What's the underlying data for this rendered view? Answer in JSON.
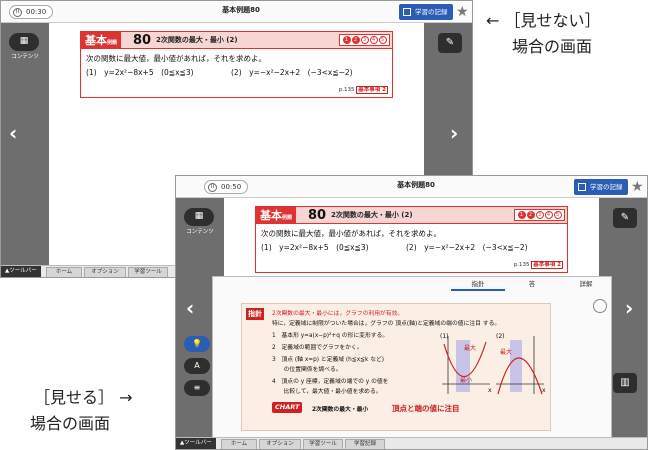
{
  "annotations": {
    "hidden_line1": "← ［見せない］",
    "hidden_line2": "場合の画面",
    "shown_line1": "［見せる］ →",
    "shown_line2": "場合の画面"
  },
  "common": {
    "app_title": "基本例題80",
    "record_label": "学習の記録",
    "star": "★",
    "contents_label": "コンテンツ",
    "toolbar_label": "▲ツールバー",
    "toolbar_tabs": [
      "ホーム",
      "オプション",
      "学習ツール",
      "学習記録"
    ],
    "problem": {
      "kihon": "基本",
      "kihon_small": "例題",
      "number": "80",
      "title": "2次関数の最大・最小 (2)",
      "circles": [
        "①",
        "②",
        "③",
        "④",
        "⑤"
      ],
      "statement": "次の関数に最大値，最小値があれば，それを求めよ。",
      "item1": "(1)　y=2x²−8x+5　(0≦x≦3)",
      "item2": "(2)　y=−x²−2x+2　(−3<x≦−2)",
      "ref_text": "p.135",
      "ref_badge": "基本事項 2"
    }
  },
  "screen_hidden": {
    "timer": "00:30"
  },
  "screen_shown": {
    "timer": "00:50",
    "panel_tabs": [
      "指針",
      "答",
      "詳解"
    ],
    "hint_tag": "指針",
    "hint_lines": [
      "2次関数の最大・最小には，グラフの利用が有効。",
      "特に，定義域に制限がついた場合は，グラフの 頂点(軸)と定義域の端の値に注目 する。",
      "1　基本形 y=a(x−p)²+q の形に変形する。",
      "2　定義域の範囲でグラフをかく。",
      "3　頂点 (軸 x=p) と定義域 (h≦x≦k など)",
      "　　の位置関係を調べる。",
      "4　頂点の y 座標，定義域の端での y の値を",
      "　　比較して，最大値・最小値を求める。"
    ],
    "chart_badge": "CHART",
    "chart_text1": "2次関数の最大・最小",
    "chart_text2": "頂点と端の値に注目",
    "graph_labels": {
      "g1": "(1)",
      "g2": "(2)",
      "max": "最大",
      "min": "最小",
      "x": "x"
    },
    "left_pills": [
      {
        "icon": "💡",
        "label": "指針"
      },
      {
        "icon": "A",
        "label": "答"
      },
      {
        "icon": "≡",
        "label": "詳解"
      }
    ]
  }
}
